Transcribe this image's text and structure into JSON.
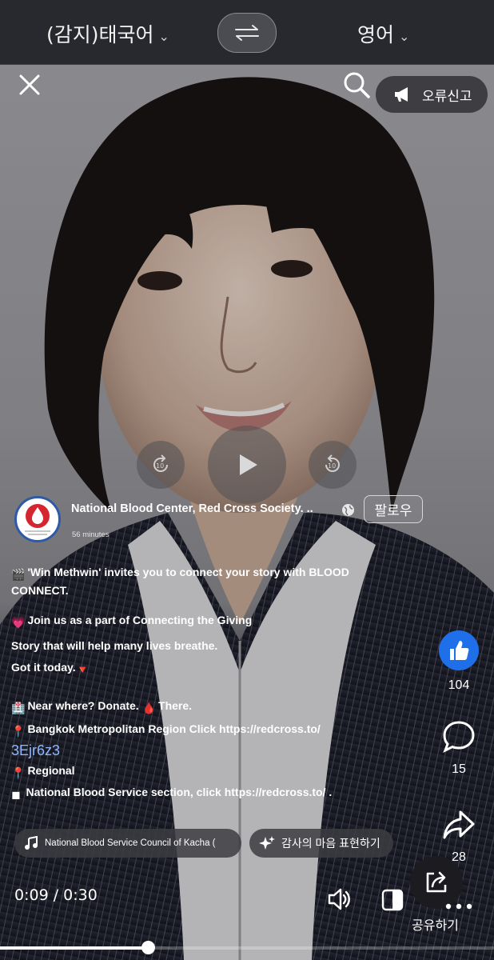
{
  "translator": {
    "source_lang": "(감지)태국어",
    "target_lang": "영어"
  },
  "overlay": {
    "report_label": "오류신고"
  },
  "post": {
    "page_name": "National Blood Center, Red Cross Society. ..",
    "time_ago": "56 minutes",
    "follow_label": "팔로우",
    "caption": {
      "line1": "'Win Methwin' invites you to connect your story with BLOOD",
      "line2": "CONNECT.",
      "line3": "Join us as a part of Connecting the Giving",
      "line4": "Story that will help many lives breathe.",
      "line5": "Got it today.",
      "line6a": "Near where? Donate.",
      "line6b": "There.",
      "line7": "Bangkok Metropolitan Region Click https://redcross.to/",
      "line8": "3Ejr6z3",
      "line9": "Regional",
      "line10": "National Blood Service section, click https://redcross.to/ ."
    }
  },
  "chips": {
    "audio": "National Blood Service Council of Kacha (",
    "gratitude": "감사의 마음 표현하기"
  },
  "reactions": {
    "likes": "104",
    "comments": "15",
    "shares": "28"
  },
  "player": {
    "current_time": "0:09",
    "separator": "/",
    "duration": "0:30",
    "progress": 0.3,
    "share_label": "공유하기"
  },
  "colors": {
    "like_blue": "#1f6fe8",
    "top_bar": "#27292e",
    "link": "#8fb6ff"
  },
  "icons": [
    "close-icon",
    "search-icon",
    "megaphone-icon",
    "swap-icon",
    "replay-10-icon",
    "play-icon",
    "forward-10-icon",
    "globe-icon",
    "thumbs-up-icon",
    "comment-icon",
    "share-arrow-icon",
    "music-note-icon",
    "sparkle-icon",
    "volume-icon",
    "contrast-icon",
    "share-box-icon",
    "more-icon"
  ]
}
